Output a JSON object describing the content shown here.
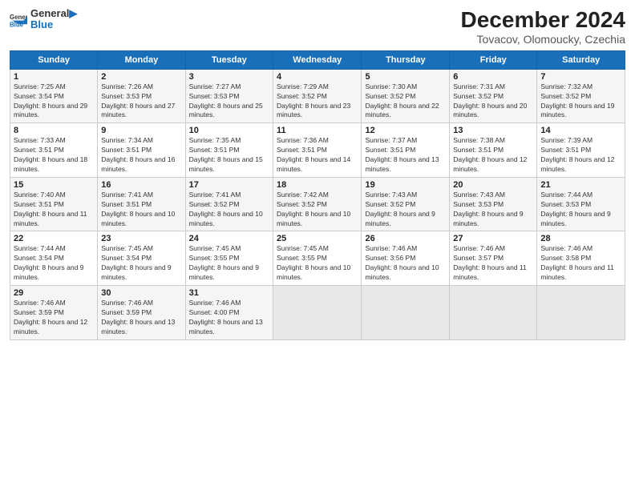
{
  "header": {
    "logo_line1": "General",
    "logo_line2": "Blue",
    "title": "December 2024",
    "subtitle": "Tovacov, Olomoucky, Czechia"
  },
  "weekdays": [
    "Sunday",
    "Monday",
    "Tuesday",
    "Wednesday",
    "Thursday",
    "Friday",
    "Saturday"
  ],
  "weeks": [
    [
      {
        "day": "1",
        "sunrise": "7:25 AM",
        "sunset": "3:54 PM",
        "daylight": "8 hours and 29 minutes."
      },
      {
        "day": "2",
        "sunrise": "7:26 AM",
        "sunset": "3:53 PM",
        "daylight": "8 hours and 27 minutes."
      },
      {
        "day": "3",
        "sunrise": "7:27 AM",
        "sunset": "3:53 PM",
        "daylight": "8 hours and 25 minutes."
      },
      {
        "day": "4",
        "sunrise": "7:29 AM",
        "sunset": "3:52 PM",
        "daylight": "8 hours and 23 minutes."
      },
      {
        "day": "5",
        "sunrise": "7:30 AM",
        "sunset": "3:52 PM",
        "daylight": "8 hours and 22 minutes."
      },
      {
        "day": "6",
        "sunrise": "7:31 AM",
        "sunset": "3:52 PM",
        "daylight": "8 hours and 20 minutes."
      },
      {
        "day": "7",
        "sunrise": "7:32 AM",
        "sunset": "3:52 PM",
        "daylight": "8 hours and 19 minutes."
      }
    ],
    [
      {
        "day": "8",
        "sunrise": "7:33 AM",
        "sunset": "3:51 PM",
        "daylight": "8 hours and 18 minutes."
      },
      {
        "day": "9",
        "sunrise": "7:34 AM",
        "sunset": "3:51 PM",
        "daylight": "8 hours and 16 minutes."
      },
      {
        "day": "10",
        "sunrise": "7:35 AM",
        "sunset": "3:51 PM",
        "daylight": "8 hours and 15 minutes."
      },
      {
        "day": "11",
        "sunrise": "7:36 AM",
        "sunset": "3:51 PM",
        "daylight": "8 hours and 14 minutes."
      },
      {
        "day": "12",
        "sunrise": "7:37 AM",
        "sunset": "3:51 PM",
        "daylight": "8 hours and 13 minutes."
      },
      {
        "day": "13",
        "sunrise": "7:38 AM",
        "sunset": "3:51 PM",
        "daylight": "8 hours and 12 minutes."
      },
      {
        "day": "14",
        "sunrise": "7:39 AM",
        "sunset": "3:51 PM",
        "daylight": "8 hours and 12 minutes."
      }
    ],
    [
      {
        "day": "15",
        "sunrise": "7:40 AM",
        "sunset": "3:51 PM",
        "daylight": "8 hours and 11 minutes."
      },
      {
        "day": "16",
        "sunrise": "7:41 AM",
        "sunset": "3:51 PM",
        "daylight": "8 hours and 10 minutes."
      },
      {
        "day": "17",
        "sunrise": "7:41 AM",
        "sunset": "3:52 PM",
        "daylight": "8 hours and 10 minutes."
      },
      {
        "day": "18",
        "sunrise": "7:42 AM",
        "sunset": "3:52 PM",
        "daylight": "8 hours and 10 minutes."
      },
      {
        "day": "19",
        "sunrise": "7:43 AM",
        "sunset": "3:52 PM",
        "daylight": "8 hours and 9 minutes."
      },
      {
        "day": "20",
        "sunrise": "7:43 AM",
        "sunset": "3:53 PM",
        "daylight": "8 hours and 9 minutes."
      },
      {
        "day": "21",
        "sunrise": "7:44 AM",
        "sunset": "3:53 PM",
        "daylight": "8 hours and 9 minutes."
      }
    ],
    [
      {
        "day": "22",
        "sunrise": "7:44 AM",
        "sunset": "3:54 PM",
        "daylight": "8 hours and 9 minutes."
      },
      {
        "day": "23",
        "sunrise": "7:45 AM",
        "sunset": "3:54 PM",
        "daylight": "8 hours and 9 minutes."
      },
      {
        "day": "24",
        "sunrise": "7:45 AM",
        "sunset": "3:55 PM",
        "daylight": "8 hours and 9 minutes."
      },
      {
        "day": "25",
        "sunrise": "7:45 AM",
        "sunset": "3:55 PM",
        "daylight": "8 hours and 10 minutes."
      },
      {
        "day": "26",
        "sunrise": "7:46 AM",
        "sunset": "3:56 PM",
        "daylight": "8 hours and 10 minutes."
      },
      {
        "day": "27",
        "sunrise": "7:46 AM",
        "sunset": "3:57 PM",
        "daylight": "8 hours and 11 minutes."
      },
      {
        "day": "28",
        "sunrise": "7:46 AM",
        "sunset": "3:58 PM",
        "daylight": "8 hours and 11 minutes."
      }
    ],
    [
      {
        "day": "29",
        "sunrise": "7:46 AM",
        "sunset": "3:59 PM",
        "daylight": "8 hours and 12 minutes."
      },
      {
        "day": "30",
        "sunrise": "7:46 AM",
        "sunset": "3:59 PM",
        "daylight": "8 hours and 13 minutes."
      },
      {
        "day": "31",
        "sunrise": "7:46 AM",
        "sunset": "4:00 PM",
        "daylight": "8 hours and 13 minutes."
      },
      null,
      null,
      null,
      null
    ]
  ]
}
